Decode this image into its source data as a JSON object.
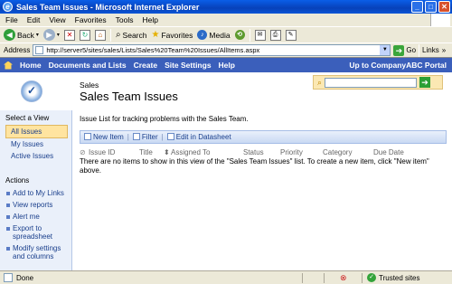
{
  "window": {
    "title": "Sales Team Issues - Microsoft Internet Explorer"
  },
  "menu": [
    "File",
    "Edit",
    "View",
    "Favorites",
    "Tools",
    "Help"
  ],
  "toolbar": {
    "back": "Back",
    "search": "Search",
    "favorites": "Favorites",
    "media": "Media"
  },
  "address": {
    "label": "Address",
    "url": "http://server5/sites/sales/Lists/Sales%20Team%20Issues/AllItems.aspx",
    "go": "Go",
    "links": "Links"
  },
  "topnav": {
    "items": [
      "Home",
      "Documents and Lists",
      "Create",
      "Site Settings",
      "Help"
    ],
    "portal": "Up to CompanyABC Portal"
  },
  "header": {
    "site": "Sales",
    "title": "Sales Team Issues"
  },
  "leftnav": {
    "view_header": "Select a View",
    "views": [
      "All Issues",
      "My Issues",
      "Active Issues"
    ],
    "actions_header": "Actions",
    "actions": [
      "Add to My Links",
      "View reports",
      "Alert me",
      "Export to spreadsheet",
      "Modify settings and columns"
    ]
  },
  "main": {
    "description": "Issue List for tracking problems with the Sales Team.",
    "toolbar": {
      "new_item": "New Item",
      "filter": "Filter",
      "datasheet": "Edit in Datasheet"
    },
    "columns": [
      "Issue ID",
      "Title",
      "Assigned To",
      "Status",
      "Priority",
      "Category",
      "Due Date"
    ],
    "empty_message": "There are no items to show in this view of the \"Sales Team Issues\" list. To create a new item, click \"New item\" above."
  },
  "status": {
    "text": "Done",
    "zone": "Trusted sites"
  }
}
